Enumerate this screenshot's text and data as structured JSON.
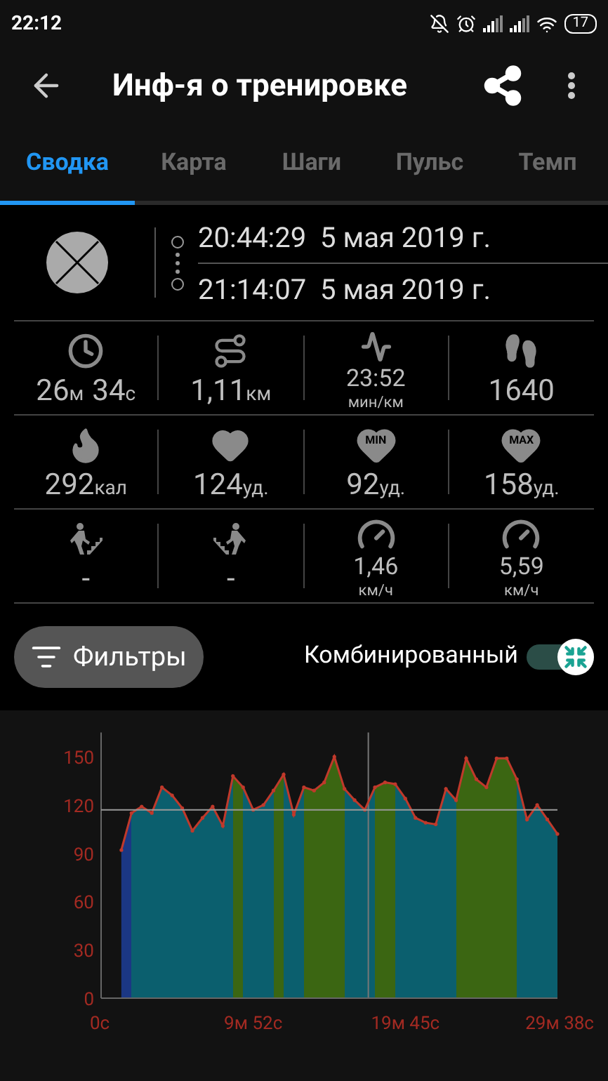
{
  "status_bar": {
    "time": "22:12",
    "battery": "17"
  },
  "app_bar": {
    "title": "Инф-я о тренировке"
  },
  "tabs": [
    {
      "label": "Сводка",
      "selected": true
    },
    {
      "label": "Карта",
      "selected": false
    },
    {
      "label": "Шаги",
      "selected": false
    },
    {
      "label": "Пульс",
      "selected": false
    },
    {
      "label": "Темп",
      "selected": false
    }
  ],
  "session": {
    "start": "20:44:29  5 мая 2019 г.",
    "end": "21:14:07  5 мая 2019 г."
  },
  "stats": [
    {
      "kind": "duration",
      "parts": [
        {
          "value": "26",
          "unit": "м"
        },
        {
          "value": "34",
          "unit": "с"
        }
      ]
    },
    {
      "kind": "distance",
      "parts": [
        {
          "value": "1,11",
          "unit": "км"
        }
      ]
    },
    {
      "kind": "pace",
      "parts": [
        {
          "value": "23:52",
          "unit": "мин/км"
        }
      ]
    },
    {
      "kind": "steps",
      "parts": [
        {
          "value": "1640"
        }
      ]
    },
    {
      "kind": "calories",
      "parts": [
        {
          "value": "292",
          "unit": "кал"
        }
      ]
    },
    {
      "kind": "heart-avg",
      "parts": [
        {
          "value": "124",
          "unit": "уд."
        }
      ]
    },
    {
      "kind": "heart-min",
      "icon_text": "MIN",
      "parts": [
        {
          "value": "92",
          "unit": "уд."
        }
      ]
    },
    {
      "kind": "heart-max",
      "icon_text": "MAX",
      "parts": [
        {
          "value": "158",
          "unit": "уд."
        }
      ]
    },
    {
      "kind": "ascent",
      "parts": [
        {
          "value": "-"
        }
      ]
    },
    {
      "kind": "descent",
      "parts": [
        {
          "value": "-"
        }
      ]
    },
    {
      "kind": "speed-avg",
      "parts": [
        {
          "value": "1,46",
          "unit": "км/ч"
        }
      ]
    },
    {
      "kind": "speed-max",
      "parts": [
        {
          "value": "5,59",
          "unit": "км/ч"
        }
      ]
    }
  ],
  "filters_button": {
    "label": "Фильтры"
  },
  "combined_toggle": {
    "label": "Комбинированный",
    "on": true
  },
  "chart_data": {
    "type": "line",
    "ylim": [
      0,
      165
    ],
    "yticks": [
      0,
      30,
      60,
      90,
      120,
      150
    ],
    "categories": [
      "0с",
      null,
      null,
      null,
      null,
      null,
      null,
      null,
      null,
      null,
      null,
      null,
      null,
      null,
      null,
      "9м 52с",
      null,
      null,
      null,
      null,
      null,
      null,
      null,
      null,
      null,
      null,
      null,
      null,
      null,
      null,
      "19м 45с",
      null,
      null,
      null,
      null,
      null,
      null,
      null,
      null,
      null,
      null,
      null,
      null,
      null,
      null,
      "29м 38с"
    ],
    "series": [
      {
        "color": "#c0392b",
        "values": [
          null,
          null,
          92,
          115,
          119,
          115,
          131,
          126,
          118,
          104,
          112,
          119,
          107,
          138,
          131,
          117,
          120,
          129,
          139,
          114,
          131,
          129,
          134,
          150,
          130,
          123,
          117,
          131,
          134,
          133,
          124,
          112,
          109,
          108,
          130,
          123,
          149,
          136,
          131,
          149,
          149,
          136,
          111,
          120,
          111,
          102
        ]
      }
    ],
    "ref_lines": [
      {
        "axis": "y",
        "value": 117
      }
    ]
  }
}
